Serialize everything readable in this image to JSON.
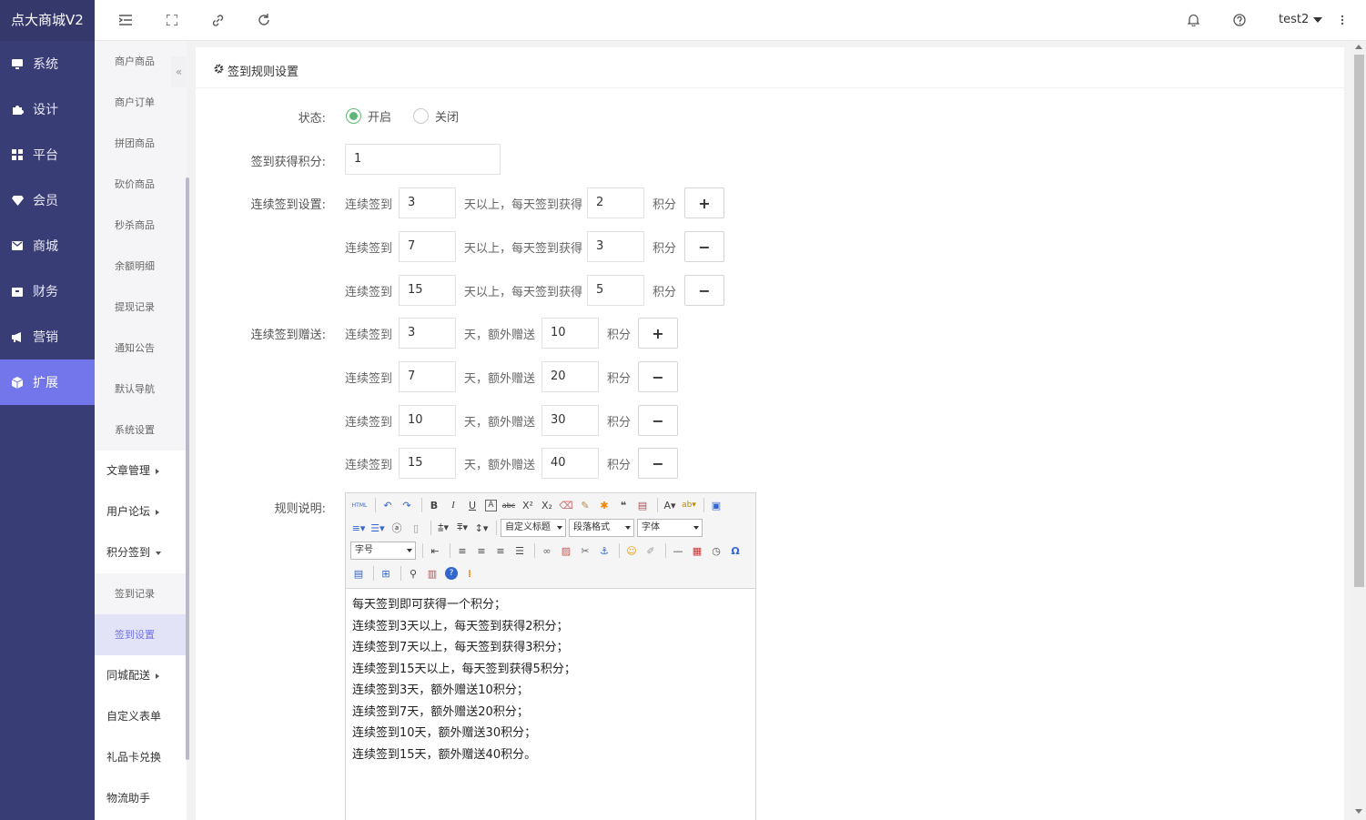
{
  "app": {
    "title": "点大商城V2"
  },
  "nav1": [
    {
      "label": "系统",
      "icon": "monitor-icon"
    },
    {
      "label": "设计",
      "icon": "puzzle-icon"
    },
    {
      "label": "平台",
      "icon": "grid-icon"
    },
    {
      "label": "会员",
      "icon": "diamond-icon"
    },
    {
      "label": "商城",
      "icon": "mail-icon"
    },
    {
      "label": "财务",
      "icon": "wallet-icon"
    },
    {
      "label": "营销",
      "icon": "megaphone-icon"
    },
    {
      "label": "扩展",
      "icon": "cube-icon",
      "active": true
    }
  ],
  "header": {
    "user": "test2"
  },
  "nav2": {
    "subs": [
      "商户商品",
      "商户订单",
      "拼团商品",
      "砍价商品",
      "秒杀商品",
      "余额明细",
      "提现记录",
      "通知公告",
      "默认导航",
      "系统设置"
    ],
    "groups": [
      "文章管理",
      "用户论坛",
      "积分签到"
    ],
    "sign_subs": [
      "签到记录",
      "签到设置"
    ],
    "more": [
      "同城配送",
      "自定义表单",
      "礼品卡兑换",
      "物流助手"
    ]
  },
  "page": {
    "title": "签到规则设置",
    "status_label": "状态:",
    "status_on": "开启",
    "status_off": "关闭",
    "points_label": "签到获得积分:",
    "points_value": "1",
    "continuous_label": "连续签到设置:",
    "continuous_rows": [
      {
        "days": "3",
        "points": "2",
        "btn": "+"
      },
      {
        "days": "7",
        "points": "3",
        "btn": "−"
      },
      {
        "days": "15",
        "points": "5",
        "btn": "−"
      }
    ],
    "gift_label": "连续签到赠送:",
    "gift_rows": [
      {
        "days": "3",
        "points": "10",
        "btn": "+"
      },
      {
        "days": "7",
        "points": "20",
        "btn": "−"
      },
      {
        "days": "10",
        "points": "30",
        "btn": "−"
      },
      {
        "days": "15",
        "points": "40",
        "btn": "−"
      }
    ],
    "txt_continuous": "连续签到",
    "txt_above": "天以上，每天签到获得",
    "txt_points": "积分",
    "txt_gift": "天，额外赠送",
    "rules_label": "规则说明:",
    "editor": {
      "sel_title": "自定义标题",
      "sel_para": "段落格式",
      "sel_font": "字体",
      "sel_size": "字号",
      "html_btn": "HTML",
      "lines": [
        "每天签到即可获得一个积分；",
        "连续签到3天以上，每天签到获得2积分；",
        "连续签到7天以上，每天签到获得3积分；",
        "连续签到15天以上，每天签到获得5积分；",
        "连续签到3天，额外赠送10积分；",
        "连续签到7天，额外赠送20积分；",
        "连续签到10天，额外赠送30积分；",
        "连续签到15天，额外赠送40积分。"
      ]
    }
  }
}
